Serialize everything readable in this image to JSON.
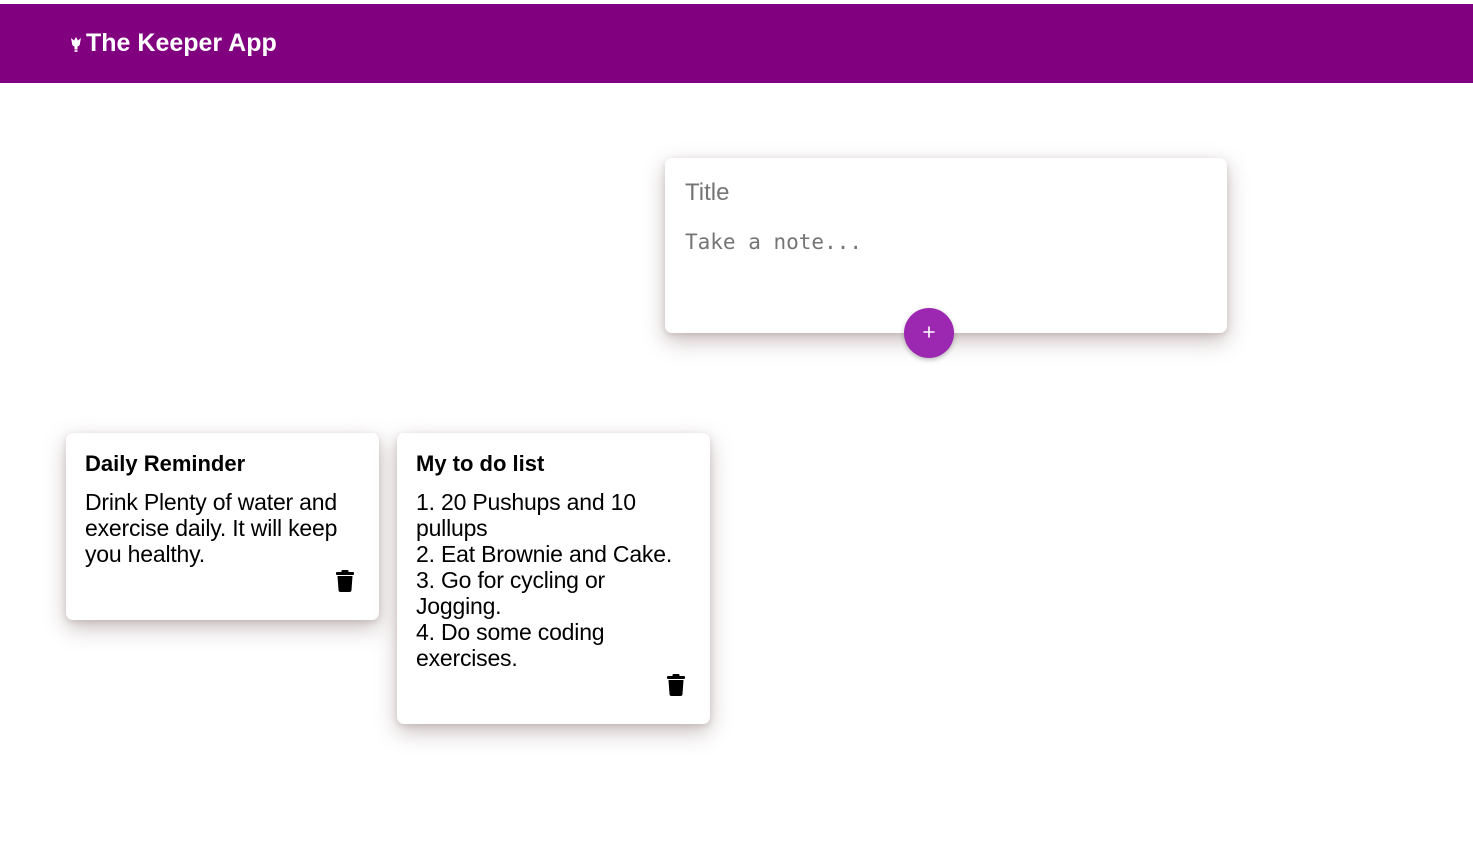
{
  "header": {
    "title": "The Keeper App",
    "icon": "lightbulb-icon",
    "background_color": "#800080"
  },
  "create_note": {
    "title_placeholder": "Title",
    "title_value": "",
    "content_placeholder": "Take a note...",
    "content_value": "",
    "add_button_label": "+",
    "add_button_color": "#9c27b0"
  },
  "notes": [
    {
      "title": "Daily Reminder",
      "content": "Drink Plenty of water and exercise daily. It will keep you healthy.",
      "delete_icon": "trash-icon"
    },
    {
      "title": "My to do list",
      "content": "1. 20 Pushups and 10 pullups\n2. Eat Brownie and Cake.\n3. Go for cycling or Jogging.\n4. Do some coding exercises.",
      "delete_icon": "trash-icon"
    }
  ]
}
